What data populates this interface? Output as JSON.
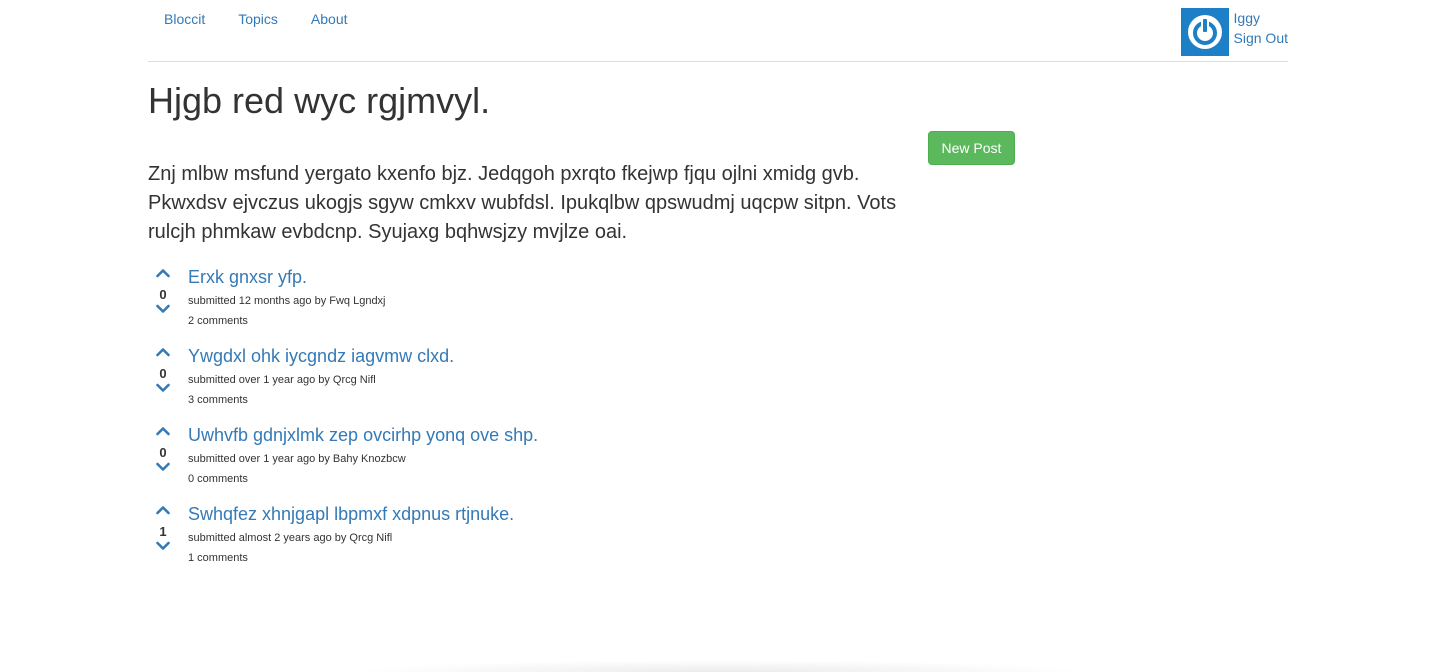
{
  "nav": {
    "links": [
      "Bloccit",
      "Topics",
      "About"
    ],
    "user_name": "Iggy",
    "sign_out": "Sign Out",
    "avatar_icon": "power-icon",
    "avatar_color": "#1d7fc6"
  },
  "topic": {
    "title": "Hjgb red wyc rgjmvyl.",
    "description": "Znj mlbw msfund yergato kxenfo bjz. Jedqgoh pxrqto fkejwp fjqu ojlni xmidg gvb. Pkwxdsv ejvczus ukogjs sgyw cmkxv wubfdsl. Ipukqlbw qpswudmj uqcpw sitpn. Vots rulcjh phmkaw evbdcnp. Syujaxg bqhwsjzy mvjlze oai.",
    "new_post_label": "New Post"
  },
  "posts": [
    {
      "title": "Erxk gnxsr yfp.",
      "votes": "0",
      "meta": "submitted 12 months ago by Fwq Lgndxj",
      "comments": "2 comments"
    },
    {
      "title": "Ywgdxl ohk iycgndz iagvmw clxd.",
      "votes": "0",
      "meta": "submitted over 1 year ago by Qrcg Nifl",
      "comments": "3 comments"
    },
    {
      "title": "Uwhvfb gdnjxlmk zep ovcirhp yonq ove shp.",
      "votes": "0",
      "meta": "submitted over 1 year ago by Bahy Knozbcw",
      "comments": "0 comments"
    },
    {
      "title": "Swhqfez xhnjgapl lbpmxf xdpnus rtjnuke.",
      "votes": "1",
      "meta": "submitted almost 2 years ago by Qrcg Nifl",
      "comments": "1 comments"
    }
  ],
  "colors": {
    "link": "#337ab7",
    "success": "#5cb85c",
    "text": "#333333"
  }
}
